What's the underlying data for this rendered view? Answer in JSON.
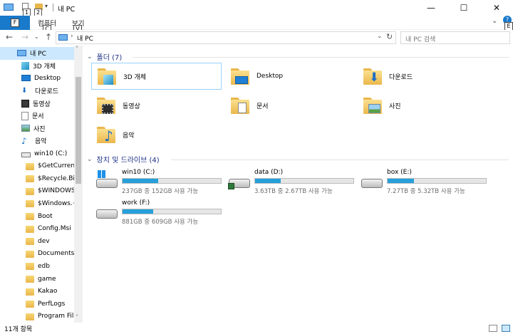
{
  "title_bar": {
    "title": "내 PC",
    "qa_badges": [
      "1",
      "2"
    ],
    "minimize": "—",
    "maximize": "☐",
    "close": "✕"
  },
  "ribbon": {
    "file_label": "F",
    "tabs": [
      "컴퓨터",
      "보기"
    ],
    "tab_keys": [
      "C",
      "V"
    ],
    "expand_key": "E",
    "help": "?"
  },
  "address_bar": {
    "path": "내 PC",
    "search_placeholder": "내 PC 검색"
  },
  "sidebar": {
    "items": [
      {
        "label": "내 PC",
        "icon": "pc-icon"
      },
      {
        "label": "3D 개체",
        "icon": "3d-objects-icon"
      },
      {
        "label": "Desktop",
        "icon": "desktop-icon"
      },
      {
        "label": "다운로드",
        "icon": "downloads-icon"
      },
      {
        "label": "동영상",
        "icon": "videos-icon"
      },
      {
        "label": "문서",
        "icon": "documents-icon"
      },
      {
        "label": "사진",
        "icon": "pictures-icon"
      },
      {
        "label": "음악",
        "icon": "music-icon"
      },
      {
        "label": "win10 (C:)",
        "icon": "drive-icon"
      },
      {
        "label": "$GetCurrent",
        "icon": "folder-icon"
      },
      {
        "label": "$Recycle.Bin",
        "icon": "folder-icon"
      },
      {
        "label": "$WINDOWS.~BT",
        "icon": "folder-icon"
      },
      {
        "label": "$Windows.~WS",
        "icon": "folder-icon"
      },
      {
        "label": "Boot",
        "icon": "folder-icon"
      },
      {
        "label": "Config.Msi",
        "icon": "folder-icon"
      },
      {
        "label": "dev",
        "icon": "folder-icon"
      },
      {
        "label": "Documents and Settings",
        "icon": "shortcut-folder-icon"
      },
      {
        "label": "edb",
        "icon": "folder-icon"
      },
      {
        "label": "game",
        "icon": "folder-icon"
      },
      {
        "label": "Kakao",
        "icon": "folder-icon"
      },
      {
        "label": "PerfLogs",
        "icon": "folder-icon"
      },
      {
        "label": "Program Files",
        "icon": "folder-icon"
      }
    ]
  },
  "main": {
    "folders_header": "폴더 (7)",
    "folders": [
      {
        "label": "3D 개체",
        "icon": "3d-objects-icon"
      },
      {
        "label": "Desktop",
        "icon": "desktop-icon"
      },
      {
        "label": "다운로드",
        "icon": "downloads-icon"
      },
      {
        "label": "동영상",
        "icon": "videos-icon"
      },
      {
        "label": "문서",
        "icon": "documents-icon"
      },
      {
        "label": "사진",
        "icon": "pictures-icon"
      },
      {
        "label": "음악",
        "icon": "music-icon"
      }
    ],
    "drives_header": "장치 및 드라이브 (4)",
    "drives": [
      {
        "name": "win10 (C:)",
        "info": "237GB 중 152GB 사용 가능",
        "used_fraction": 0.36,
        "icon": "windows-drive-icon"
      },
      {
        "name": "data (D:)",
        "info": "3.63TB 중 2.67TB 사용 가능",
        "used_fraction": 0.26,
        "icon": "data-drive-icon"
      },
      {
        "name": "box (E:)",
        "info": "7.27TB 중 5.32TB 사용 가능",
        "used_fraction": 0.27,
        "icon": "drive-icon"
      },
      {
        "name": "work (F:)",
        "info": "881GB 중 609GB 사용 가능",
        "used_fraction": 0.31,
        "icon": "drive-icon"
      }
    ]
  },
  "status_bar": {
    "item_count": "11개 항목"
  },
  "colors": {
    "accent": "#1979ca",
    "selection": "#cce8ff",
    "bar_fill": "#26a0da",
    "header_text": "#1e3287"
  }
}
